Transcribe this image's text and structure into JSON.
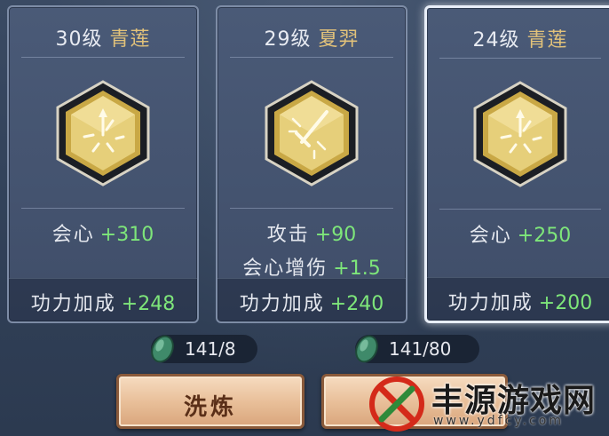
{
  "cards": [
    {
      "level": "30级",
      "name": "青莲",
      "stats": [
        {
          "label": "会心",
          "value": "+310"
        }
      ],
      "bonus_label": "功力加成",
      "bonus_value": "+248",
      "emblem_icon": "spark-burst-icon",
      "selected": false
    },
    {
      "level": "29级",
      "name": "夏羿",
      "stats": [
        {
          "label": "攻击",
          "value": "+90"
        },
        {
          "label": "会心增伤",
          "value": "+1.5"
        }
      ],
      "bonus_label": "功力加成",
      "bonus_value": "+240",
      "emblem_icon": "sword-burst-icon",
      "selected": false
    },
    {
      "level": "24级",
      "name": "青莲",
      "stats": [
        {
          "label": "会心",
          "value": "+250"
        }
      ],
      "bonus_label": "功力加成",
      "bonus_value": "+200",
      "emblem_icon": "spark-burst-icon",
      "selected": true
    }
  ],
  "costs": [
    {
      "text": "141/8",
      "icon": "jade-stone-icon"
    },
    {
      "text": "141/80",
      "icon": "jade-stone-icon"
    }
  ],
  "buttons": {
    "refine": "洗炼"
  },
  "watermark": {
    "text": "丰源游戏网",
    "url": "www.ydfcy.com"
  },
  "colors": {
    "stat_value": "#7ee67a",
    "name_gold": "#e2c27a",
    "card_bg": "#44536f",
    "button_bg": "#e9c09a"
  }
}
